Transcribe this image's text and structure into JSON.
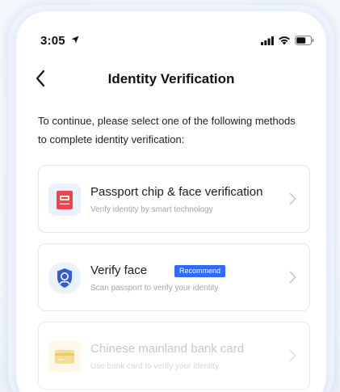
{
  "status_bar": {
    "time": "3:05"
  },
  "header": {
    "title": "Identity Verification"
  },
  "instructions": "To continue, please select one of the following methods to complete identity verification:",
  "options": [
    {
      "title": "Passport chip & face verification",
      "subtitle": "Verify identity by smart technology",
      "icon": "passport-chip-icon",
      "enabled": true
    },
    {
      "title": "Verify face",
      "badge": "Recommend",
      "subtitle": "Scan passport to verify your identity",
      "icon": "face-shield-icon",
      "enabled": true
    },
    {
      "title": "Chinese mainland bank card",
      "subtitle": "Use bank card to verify your identity",
      "icon": "bank-card-icon",
      "enabled": false
    }
  ],
  "colors": {
    "accent": "#2f6bff",
    "chip_red": "#e5484d",
    "card_border": "#e4e7ec",
    "disabled_text": "#c4c6cb"
  }
}
